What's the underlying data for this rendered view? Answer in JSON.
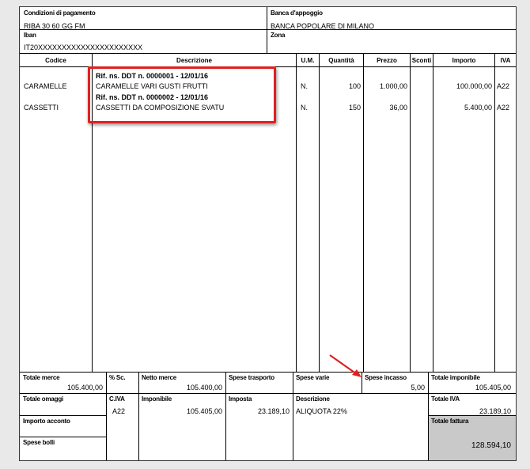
{
  "header": {
    "payment_label": "Condizioni di pagamento",
    "payment_value": "RIBA 30 60 GG FM",
    "bank_label": "Banca d'appoggio",
    "bank_value": "BANCA POPOLARE DI MILANO",
    "iban_label": "Iban",
    "iban_value": "IT20XXXXXXXXXXXXXXXXXXXXXX",
    "zone_label": "Zona"
  },
  "columns": {
    "code": "Codice",
    "description": "Descrizione",
    "um": "U.M.",
    "qty": "Quantità",
    "price": "Prezzo",
    "discount": "Sconti",
    "amount": "Importo",
    "vat": "IVA"
  },
  "lines": [
    {
      "ref": "Rif. ns. DDT n.     0000001  -  12/01/16",
      "code": "CARAMELLE",
      "description": "CARAMELLE VARI GUSTI FRUTTI",
      "um": "N.",
      "qty": "100",
      "price": "1.000,00",
      "amount": "100.000,00",
      "vat": "A22"
    },
    {
      "ref": "Rif. ns. DDT n.     0000002  -  12/01/16",
      "code": "CASSETTI",
      "description": "CASSETTI DA COMPOSIZIONE SVATU",
      "um": "N.",
      "qty": "150",
      "price": "36,00",
      "amount": "5.400,00",
      "vat": "A22"
    }
  ],
  "totals": {
    "goods_label": "Totale merce",
    "goods_value": "105.400,00",
    "discount_label": "% Sc.",
    "net_label": "Netto merce",
    "net_value": "105.400,00",
    "transport_label": "Spese trasporto",
    "misc_label": "Spese varie",
    "collection_label": "Spese incasso",
    "collection_value": "5,00",
    "taxable_total_label": "Totale imponibile",
    "taxable_total_value": "105.405,00",
    "gifts_label": "Totale omaggi",
    "vat_code_label": "C.IVA",
    "vat_code_value": "A22",
    "taxable_label": "Imponibile",
    "taxable_value": "105.405,00",
    "tax_label": "Imposta",
    "tax_value": "23.189,10",
    "desc_label": "Descrizione",
    "desc_value": "ALIQUOTA 22%",
    "vat_total_label": "Totale IVA",
    "vat_total_value": "23.189,10",
    "deposit_label": "Importo acconto",
    "invoice_total_label": "Totale fattura",
    "invoice_total_value": "128.594,10",
    "stamps_label": "Spese bolli"
  },
  "colors": {
    "highlight": "#e02020",
    "arrow": "#e02020",
    "total_bg": "#c9c9c9"
  }
}
